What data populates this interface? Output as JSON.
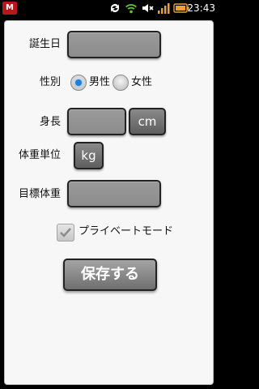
{
  "status_bar": {
    "app_badge": "M",
    "time": "23:43",
    "icons": [
      "sync-icon",
      "wifi-icon",
      "mute-icon",
      "signal-icon",
      "battery-icon"
    ]
  },
  "form": {
    "birthday": {
      "label": "誕生日",
      "value": ""
    },
    "sex": {
      "label": "性別",
      "options": [
        {
          "label": "男性",
          "checked": true
        },
        {
          "label": "女性",
          "checked": false
        }
      ]
    },
    "height": {
      "label": "身長",
      "value": "",
      "unit": "cm"
    },
    "weight_unit": {
      "label": "体重単位",
      "value": "kg"
    },
    "target_weight": {
      "label": "目標体重",
      "value": ""
    },
    "private_mode": {
      "label": "プライベートモード",
      "checked": true
    },
    "save_label": "保存する"
  },
  "colors": {
    "radio_selected": "#1d7fd9",
    "field_bg": "#8c8c8c",
    "panel_bg": "#f7f7f7"
  }
}
